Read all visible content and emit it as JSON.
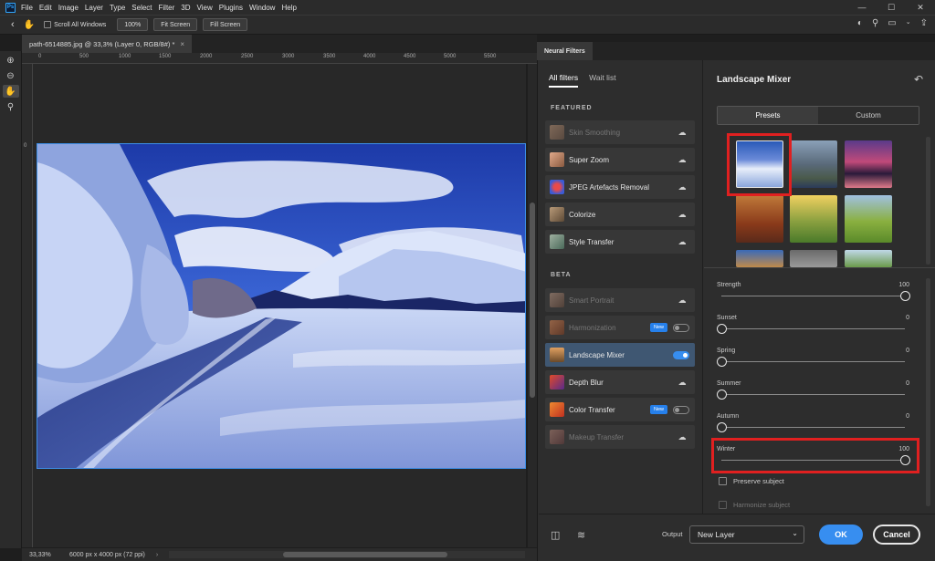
{
  "menubar": {
    "logo": "Ps",
    "items": [
      "File",
      "Edit",
      "Image",
      "Layer",
      "Type",
      "Select",
      "Filter",
      "3D",
      "View",
      "Plugins",
      "Window",
      "Help"
    ]
  },
  "options": {
    "scroll_all_windows": "Scroll All Windows",
    "zoom_100": "100%",
    "fit_screen": "Fit Screen",
    "fill_screen": "Fill Screen"
  },
  "document": {
    "tab_title": "path-6514885.jpg @ 33,3% (Layer 0, RGB/8#) *",
    "close": "×"
  },
  "rulers": {
    "h_ticks": [
      "0",
      "500",
      "1000",
      "1500",
      "2000",
      "2500",
      "3000",
      "3500",
      "4000",
      "4500",
      "5000",
      "5500"
    ],
    "v_ticks": [
      "0"
    ]
  },
  "status": {
    "zoom": "33,33%",
    "doc_size": "6000 px x 4000 px (72 ppi)"
  },
  "neural_filters": {
    "panel_title": "Neural Filters",
    "tabs": [
      "All filters",
      "Wait list"
    ],
    "featured_label": "FEATURED",
    "beta_label": "BETA",
    "featured": [
      {
        "label": "Skin Smoothing",
        "dim": true,
        "trailing": "cloud"
      },
      {
        "label": "Super Zoom",
        "dim": false,
        "trailing": "cloud"
      },
      {
        "label": "JPEG Artefacts Removal",
        "dim": false,
        "trailing": "cloud"
      },
      {
        "label": "Colorize",
        "dim": false,
        "trailing": "cloud"
      },
      {
        "label": "Style Transfer",
        "dim": false,
        "trailing": "cloud"
      }
    ],
    "beta": [
      {
        "label": "Smart Portrait",
        "dim": true,
        "trailing": "cloud"
      },
      {
        "label": "Harmonization",
        "dim": true,
        "trailing": "toggle-off",
        "badge": "New"
      },
      {
        "label": "Landscape Mixer",
        "dim": false,
        "trailing": "toggle-on",
        "selected": true
      },
      {
        "label": "Depth Blur",
        "dim": false,
        "trailing": "cloud"
      },
      {
        "label": "Color Transfer",
        "dim": false,
        "trailing": "toggle-off",
        "badge": "New"
      },
      {
        "label": "Makeup Transfer",
        "dim": true,
        "trailing": "cloud"
      }
    ]
  },
  "landscape_mixer": {
    "title": "Landscape Mixer",
    "segments": [
      "Presets",
      "Custom"
    ],
    "sliders": [
      {
        "label": "Strength",
        "value": "100",
        "level": 1.0
      },
      {
        "label": "Sunset",
        "value": "0",
        "level": 0.0
      },
      {
        "label": "Spring",
        "value": "0",
        "level": 0.0
      },
      {
        "label": "Summer",
        "value": "0",
        "level": 0.0
      },
      {
        "label": "Autumn",
        "value": "0",
        "level": 0.0
      },
      {
        "label": "Winter",
        "value": "100",
        "level": 1.0
      }
    ],
    "preserve_subject": "Preserve subject",
    "harmonize_subject": "Harmonize subject"
  },
  "footer": {
    "output_label": "Output",
    "output_value": "New Layer",
    "ok": "OK",
    "cancel": "Cancel"
  },
  "colors": {
    "accent": "#378ef0",
    "highlight": "#e02020",
    "selected_row": "#3f5772"
  }
}
